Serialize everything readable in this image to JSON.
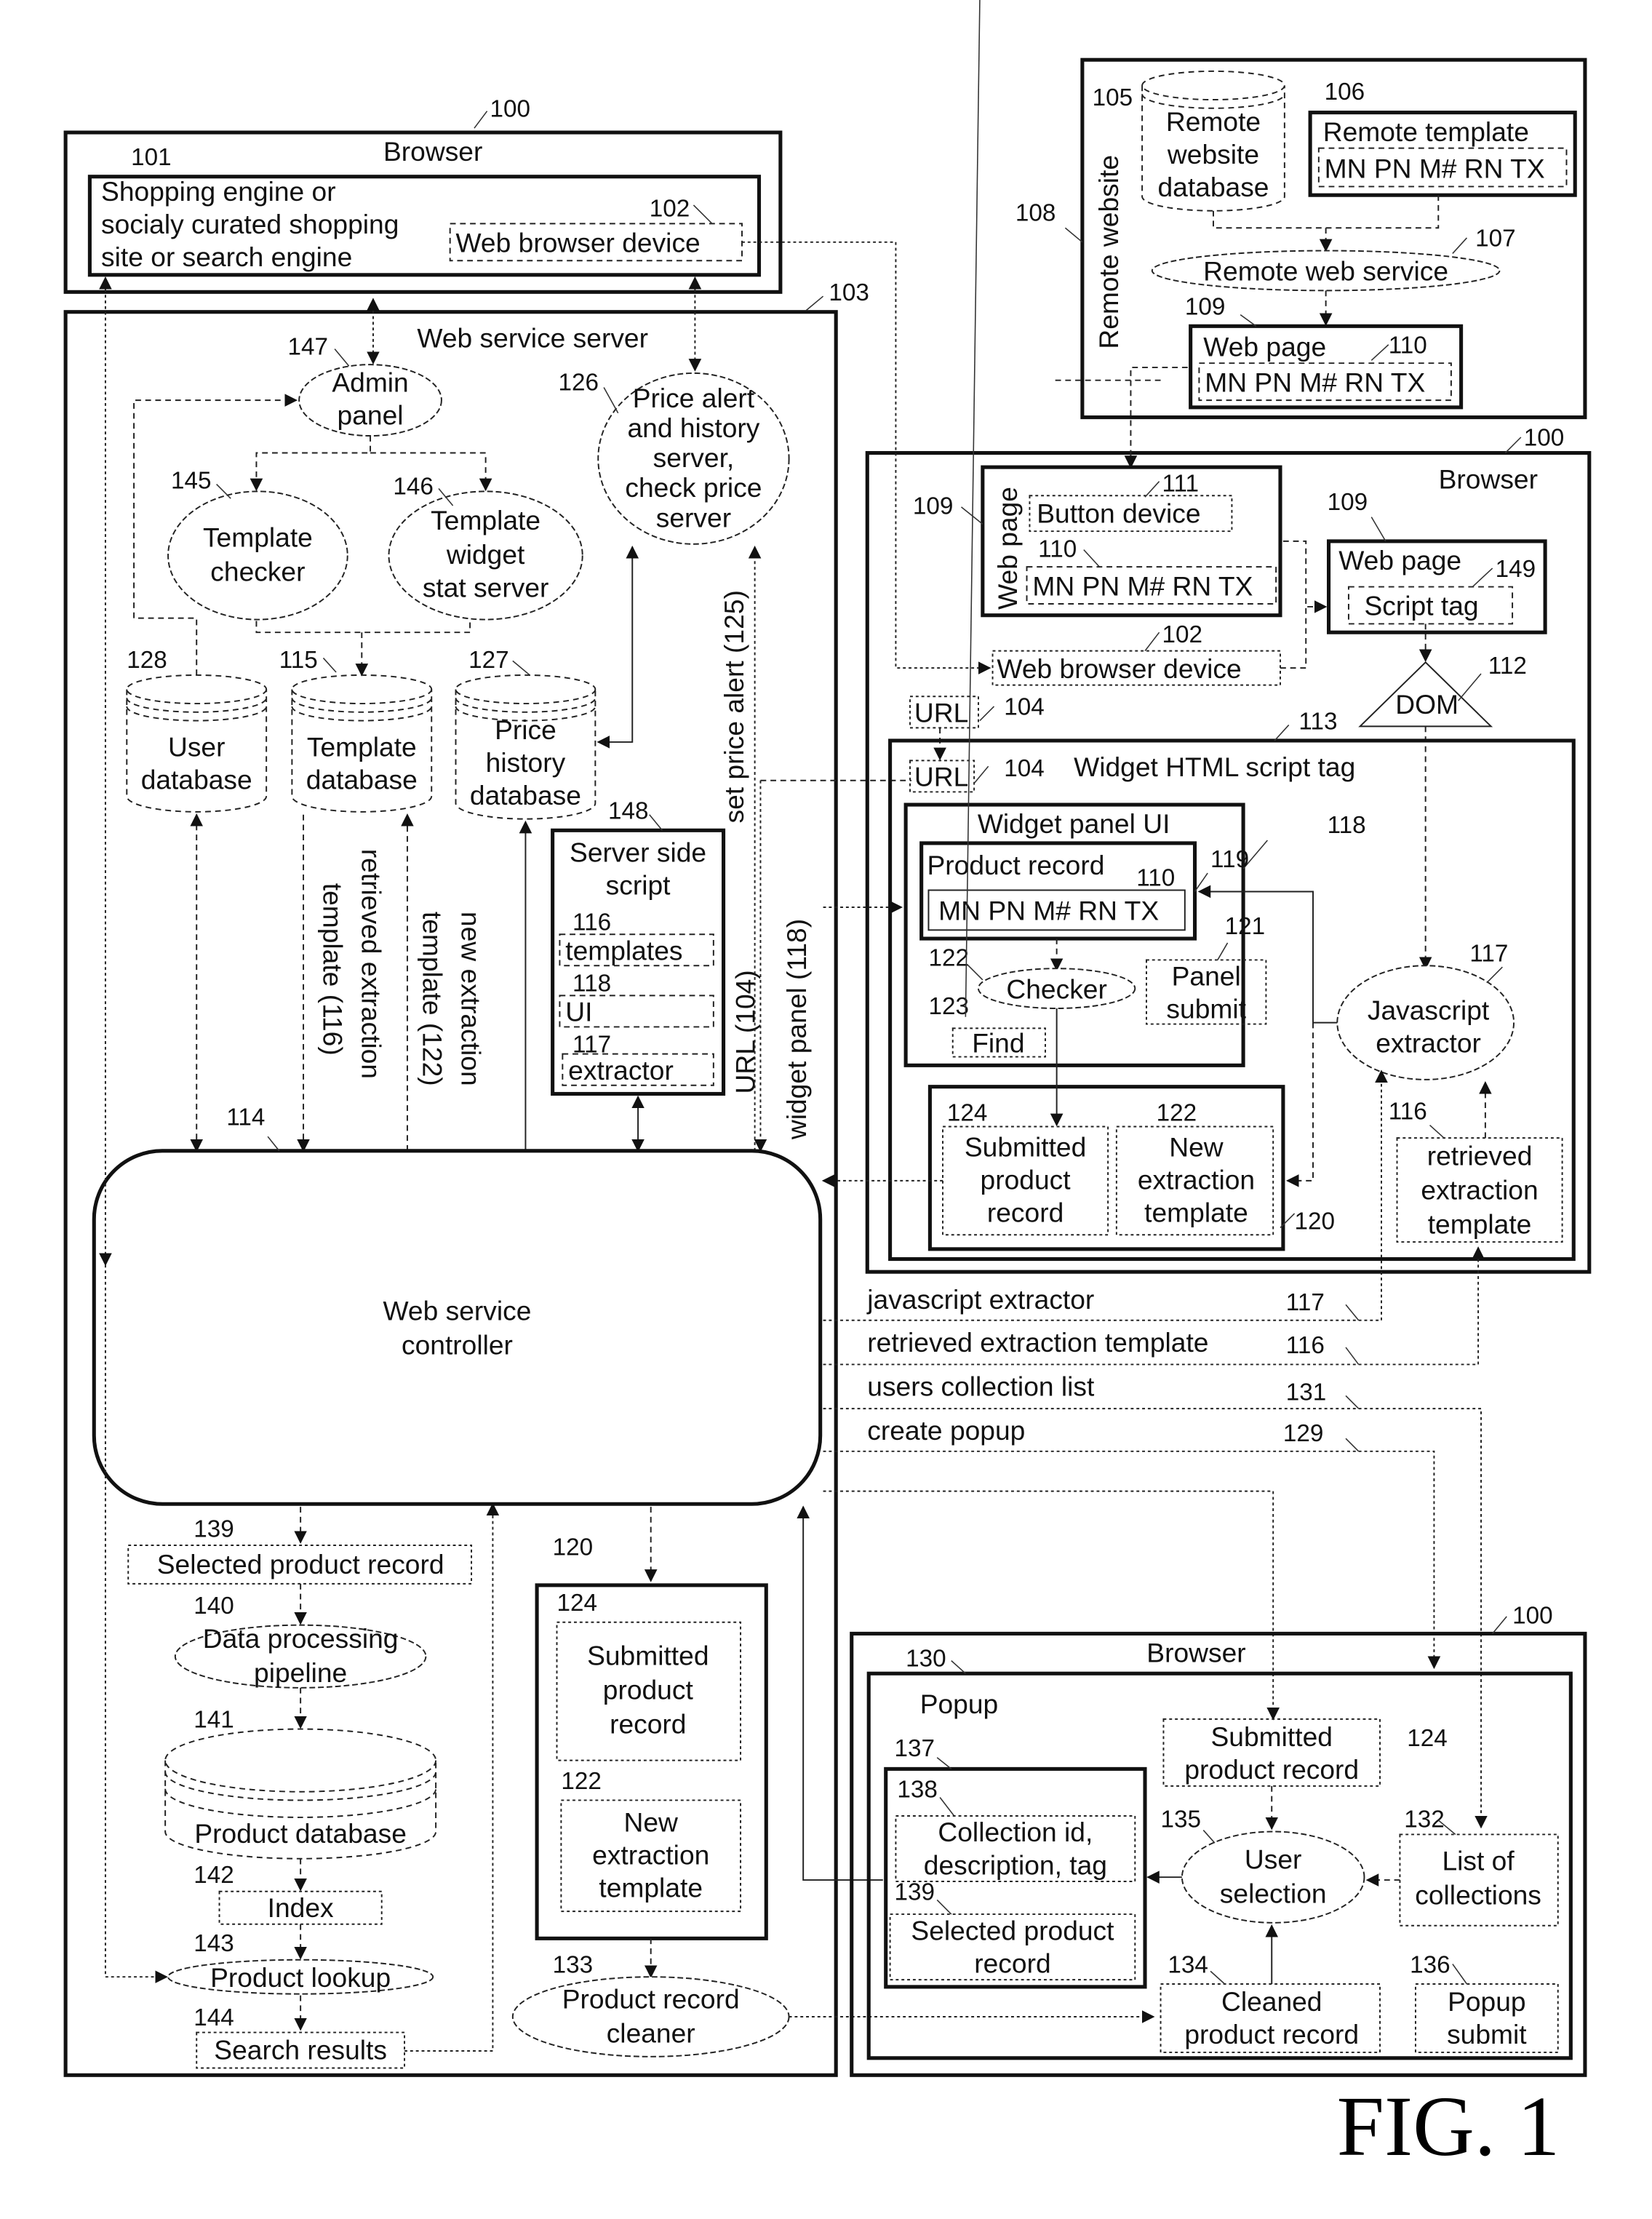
{
  "figure_label": "FIG. 1",
  "browser_top": {
    "ref": "100",
    "title": "Browser",
    "shopping": {
      "ref": "101",
      "lines": [
        "Shopping engine or",
        "socialy curated shopping",
        "site or search engine"
      ]
    },
    "web_browser_device": {
      "ref": "102",
      "label": "Web browser device"
    }
  },
  "remote_website": {
    "ref": "108",
    "title": "Remote website",
    "database": {
      "ref": "105",
      "lines": [
        "Remote",
        "website",
        "database"
      ]
    },
    "template": {
      "ref": "106",
      "title": "Remote template",
      "fields": "MN PN M# RN TX"
    },
    "web_service": {
      "ref": "107",
      "label": "Remote web service"
    },
    "web_page": {
      "ref": "109",
      "title": "Web page",
      "fields_ref": "110",
      "fields": "MN PN M# RN TX"
    }
  },
  "server": {
    "ref": "103",
    "title": "Web service server",
    "admin_panel": {
      "ref": "147",
      "lines": [
        "Admin",
        "panel"
      ]
    },
    "template_checker": {
      "ref": "145",
      "lines": [
        "Template",
        "checker"
      ]
    },
    "template_widget_stat": {
      "ref": "146",
      "lines": [
        "Template",
        "widget",
        "stat server"
      ]
    },
    "price_alert": {
      "ref": "126",
      "lines": [
        "Price alert",
        "and history",
        "server,",
        "check price",
        "server"
      ]
    },
    "user_db": {
      "ref": "128",
      "lines": [
        "User",
        "database"
      ]
    },
    "template_db": {
      "ref": "115",
      "lines": [
        "Template",
        "database"
      ]
    },
    "price_history_db": {
      "ref": "127",
      "lines": [
        "Price",
        "history",
        "database"
      ]
    },
    "server_side_script": {
      "ref": "148",
      "lines": [
        "Server side",
        "script"
      ],
      "items": [
        {
          "ref": "116",
          "label": "templates"
        },
        {
          "ref": "118",
          "label": "UI"
        },
        {
          "ref": "117",
          "label": "extractor"
        }
      ]
    },
    "flow_labels": {
      "retrieved_template": [
        "retrieved extraction",
        "template (116)"
      ],
      "new_template": [
        "new extraction",
        "template (122)"
      ],
      "url": "URL (104)",
      "widget_panel": "widget panel (118)",
      "set_price_alert": "set price alert (125)"
    },
    "controller": {
      "ref": "114",
      "lines": [
        "Web service",
        "controller"
      ]
    },
    "pipeline": [
      {
        "ref": "139",
        "label": "Selected product record"
      },
      {
        "ref": "140",
        "lines": [
          "Data processing",
          "pipeline"
        ]
      },
      {
        "ref": "141",
        "label": "Product database"
      },
      {
        "ref": "142",
        "label": "Index"
      },
      {
        "ref": "143",
        "label": "Product lookup"
      },
      {
        "ref": "144",
        "label": "Search results"
      }
    ],
    "submission": {
      "ref": "120",
      "submitted": {
        "ref": "124",
        "lines": [
          "Submitted",
          "product",
          "record"
        ]
      },
      "new_template": {
        "ref": "122",
        "lines": [
          "New",
          "extraction",
          "template"
        ]
      }
    },
    "cleaner": {
      "ref": "133",
      "lines": [
        "Product record",
        "cleaner"
      ]
    }
  },
  "browser_widget": {
    "ref": "100",
    "title": "Browser",
    "web_page_left": {
      "ref": "109",
      "vertical_title": "Web page",
      "button": {
        "ref": "111",
        "label": "Button device"
      },
      "fields_ref": "110",
      "fields": "MN PN M# RN TX"
    },
    "web_page_right": {
      "ref": "109",
      "title": "Web page",
      "script_tag": {
        "ref": "149",
        "label": "Script tag"
      }
    },
    "web_browser_device": {
      "ref": "102",
      "label": "Web browser device"
    },
    "dom": {
      "ref": "112",
      "label": "DOM"
    },
    "url_outer": {
      "ref": "104",
      "label": "URL"
    },
    "widget_script": {
      "ref": "113",
      "title": "Widget HTML script tag",
      "url_inner": {
        "ref": "104",
        "label": "URL"
      },
      "panel": {
        "ref": "118",
        "title": "Widget panel UI",
        "product_record": {
          "ref": "119",
          "title": "Product record",
          "fields_ref": "110",
          "fields": "MN PN M# RN TX"
        },
        "checker": {
          "ref": "122",
          "label": "Checker"
        },
        "find": {
          "ref": "123",
          "label": "Find"
        },
        "panel_submit": {
          "ref": "121",
          "lines": [
            "Panel",
            "submit"
          ]
        }
      },
      "submission": {
        "ref": "120",
        "submitted": {
          "ref": "124",
          "lines": [
            "Submitted",
            "product",
            "record"
          ]
        },
        "new_template": {
          "ref": "122",
          "lines": [
            "New",
            "extraction",
            "template"
          ]
        }
      },
      "js_extractor": {
        "ref": "117",
        "lines": [
          "Javascript",
          "extractor"
        ]
      },
      "retrieved_template": {
        "ref": "116",
        "lines": [
          "retrieved",
          "extraction",
          "template"
        ]
      }
    }
  },
  "channels": [
    {
      "label": "javascript extractor",
      "ref": "117"
    },
    {
      "label": "retrieved extraction template",
      "ref": "116"
    },
    {
      "label": "users collection list",
      "ref": "131"
    },
    {
      "label": "create popup",
      "ref": "129"
    }
  ],
  "browser_popup": {
    "ref": "100",
    "title": "Browser",
    "popup": {
      "ref": "130",
      "title": "Popup",
      "collection_box": {
        "ref": "137",
        "collection_info": {
          "ref": "138",
          "lines": [
            "Collection id,",
            "description, tag"
          ]
        },
        "selected_record": {
          "ref": "139",
          "lines": [
            "Selected product",
            "record"
          ]
        }
      },
      "submitted": {
        "ref": "124",
        "lines": [
          "Submitted",
          "product record"
        ]
      },
      "user_selection": {
        "ref": "135",
        "lines": [
          "User",
          "selection"
        ]
      },
      "list_collections": {
        "ref": "132",
        "lines": [
          "List of",
          "collections"
        ]
      },
      "cleaned": {
        "ref": "134",
        "lines": [
          "Cleaned",
          "product record"
        ]
      },
      "popup_submit": {
        "ref": "136",
        "lines": [
          "Popup",
          "submit"
        ]
      }
    }
  }
}
